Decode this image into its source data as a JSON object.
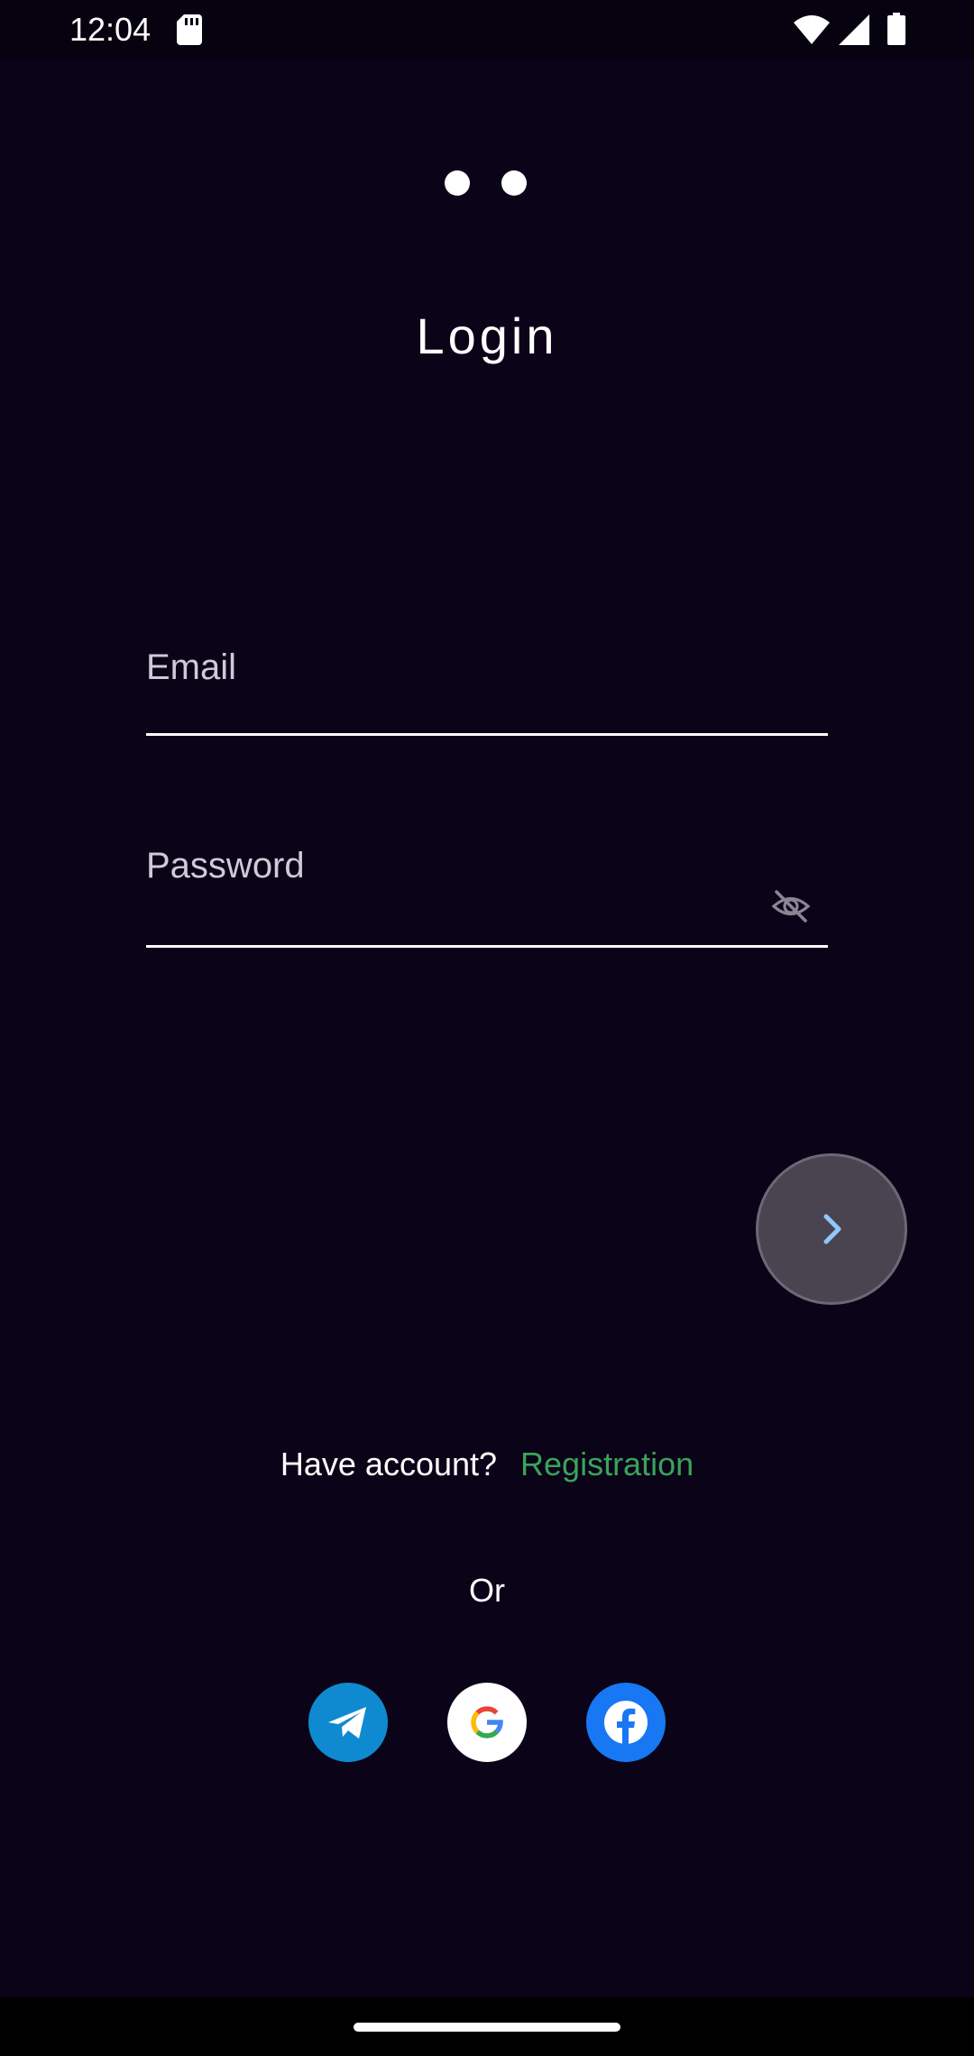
{
  "status_bar": {
    "time": "12:04",
    "icons": [
      "sd-card-icon",
      "wifi-icon",
      "signal-icon",
      "battery-icon"
    ]
  },
  "pager": {
    "dots": 2
  },
  "login": {
    "title": "Login",
    "email_placeholder": "Email",
    "email_value": "",
    "password_placeholder": "Password",
    "password_value": "",
    "password_visibility_icon": "eye-off-icon",
    "next_icon": "chevron-right-icon"
  },
  "footer": {
    "have_account": "Have account?",
    "registration": "Registration",
    "or": "Or",
    "social": [
      "telegram-icon",
      "google-icon",
      "facebook-icon"
    ]
  },
  "colors": {
    "background": "#0b0418",
    "accent_link": "#3aa35a",
    "next_button": "#4a4350",
    "next_chevron": "#8ec8ff",
    "telegram": "#0f8ad0",
    "facebook": "#1877f2"
  }
}
